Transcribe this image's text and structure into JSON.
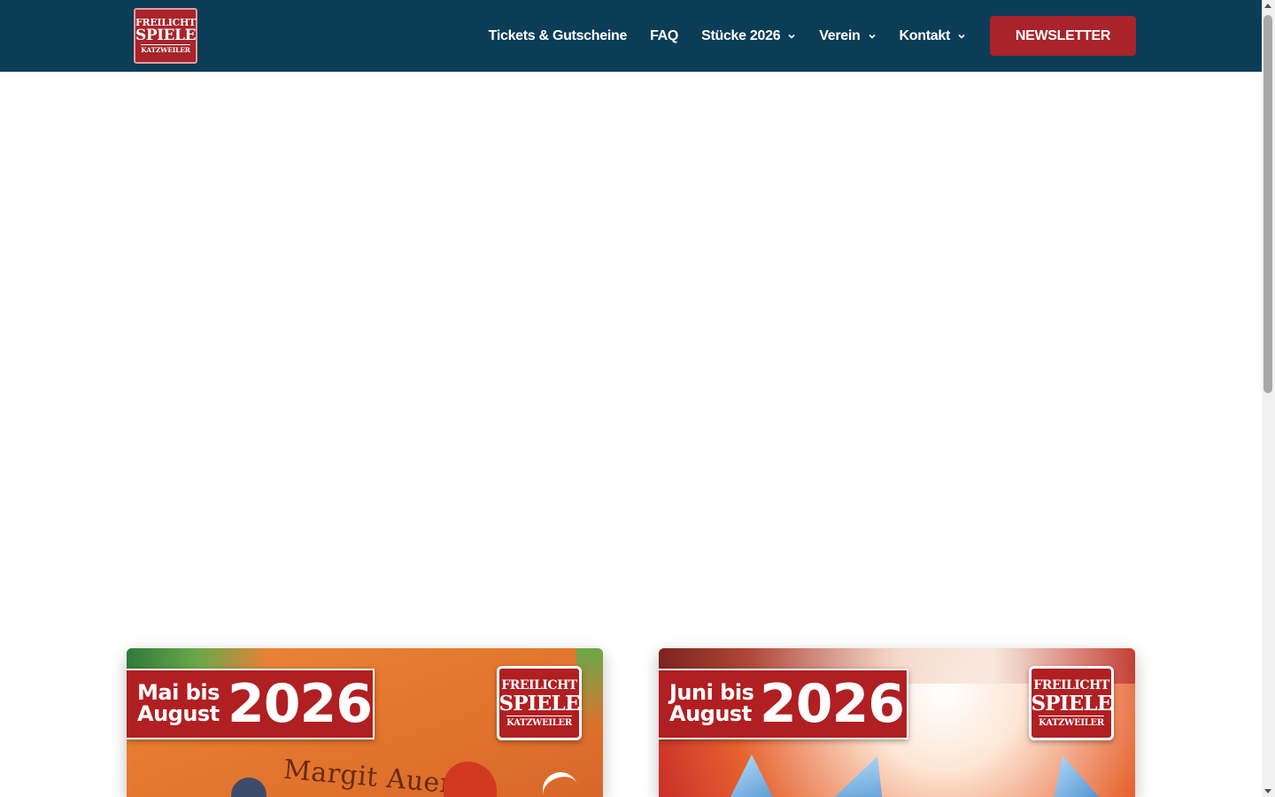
{
  "header": {
    "logo": {
      "line1": "FREILICHT",
      "line2": "SPIELE",
      "line3": "KATZWEILER"
    },
    "nav": [
      {
        "label": "Tickets & Gutscheine",
        "has_dropdown": false
      },
      {
        "label": "FAQ",
        "has_dropdown": false
      },
      {
        "label": "Stücke 2026",
        "has_dropdown": true
      },
      {
        "label": "Verein",
        "has_dropdown": true
      },
      {
        "label": "Kontakt",
        "has_dropdown": true
      }
    ],
    "newsletter_label": "NEWSLETTER"
  },
  "cards": [
    {
      "months": "Mai bis August",
      "months_line1": "Mai bis",
      "months_line2": "August",
      "year": "2026",
      "badge": {
        "line1": "FREILICHT",
        "line2": "SPIELE",
        "line3": "KATZWEILER"
      },
      "author": "Margit Auer"
    },
    {
      "months": "Juni bis August",
      "months_line1": "Juni bis",
      "months_line2": "August",
      "year": "2026",
      "badge": {
        "line1": "FREILICHT",
        "line2": "SPIELE",
        "line3": "KATZWEILER"
      }
    }
  ],
  "colors": {
    "header_bg": "#0c3d57",
    "brand_red": "#a8232a",
    "banner_red": "#b01f22",
    "text_white": "#ffffff"
  },
  "icons": {
    "dropdown": "chevron-down-icon"
  }
}
